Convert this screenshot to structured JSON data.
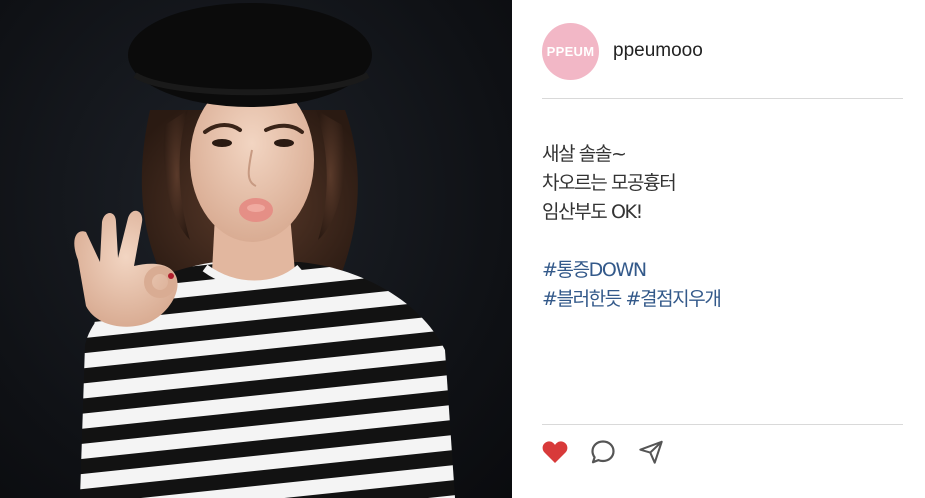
{
  "post": {
    "account": {
      "avatar_text": "PPEUM",
      "username": "ppeumooo",
      "avatar_color": "#f2b7c6"
    },
    "caption_lines": [
      "새살 솔솔~",
      "차오르는 모공흉터",
      "임산부도 OK!"
    ],
    "hashtags": [
      "#통증DOWN",
      "#블러한듯 #결점지우개"
    ],
    "actions": {
      "like_icon": "heart-icon",
      "comment_icon": "comment-icon",
      "share_icon": "send-icon",
      "like_color": "#d83a3a"
    },
    "photo_icon": "woman-in-beret-photo"
  }
}
